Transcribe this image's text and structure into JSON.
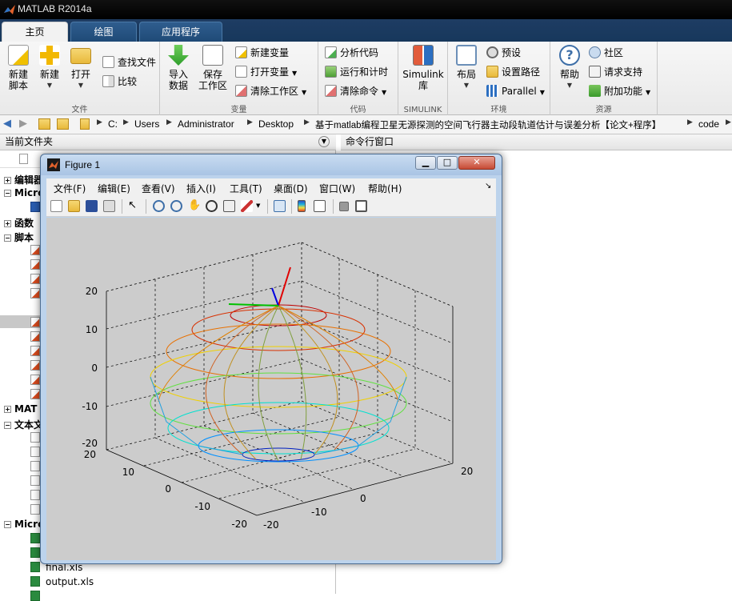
{
  "app": {
    "title": "MATLAB R2014a"
  },
  "tabs": [
    {
      "label": "主页",
      "active": true
    },
    {
      "label": "绘图",
      "active": false
    },
    {
      "label": "应用程序",
      "active": false
    }
  ],
  "ribbon": {
    "file": {
      "label": "文件",
      "new_script": "新建\n脚本",
      "new": "新建",
      "open": "打开",
      "find_files": "查找文件",
      "compare": "比较"
    },
    "variable": {
      "label": "变量",
      "import": "导入\n数据",
      "save_ws": "保存\n工作区",
      "new_var": "新建变量",
      "open_var": "打开变量",
      "clear_ws": "清除工作区"
    },
    "code": {
      "label": "代码",
      "analyze": "分析代码",
      "run_time": "运行和计时",
      "clear_cmd": "清除命令"
    },
    "simulink": {
      "label": "SIMULINK",
      "btn": "Simulink\n库"
    },
    "env": {
      "label": "环境",
      "layout": "布局",
      "prefs": "预设",
      "set_path": "设置路径",
      "parallel": "Parallel"
    },
    "resources": {
      "label": "资源",
      "help": "帮助",
      "community": "社区",
      "support": "请求支持",
      "addons": "附加功能"
    }
  },
  "address": {
    "crumbs": [
      "C:",
      "Users",
      "Administrator",
      "Desktop",
      "基于matlab编程卫星无源探测的空间飞行器主动段轨道估计与误差分析【论文+程序】",
      "code"
    ]
  },
  "left_panel": {
    "title": "当前文件夹",
    "sections": [
      "编辑器",
      "Micro",
      "函数",
      "脚本",
      "MAT",
      "文本文",
      "Micro"
    ],
    "files": [
      "final.xls",
      "output.xls"
    ]
  },
  "right_panel": {
    "title": "命令行窗口"
  },
  "figure": {
    "title": "Figure 1",
    "menu": [
      "文件(F)",
      "编辑(E)",
      "查看(V)",
      "插入(I)",
      "工具(T)",
      "桌面(D)",
      "窗口(W)",
      "帮助(H)"
    ],
    "z_ticks": [
      "20",
      "10",
      "0",
      "-10",
      "-20"
    ],
    "left_ticks": [
      "20",
      "10",
      "0",
      "-10",
      "-20"
    ],
    "right_ticks": [
      "20",
      "0",
      "-10",
      "-20"
    ]
  },
  "colors": {
    "ribbon_bg": "#f0f0f0",
    "tab_bar": "#1e3c63",
    "canvas": "#cccccc"
  }
}
